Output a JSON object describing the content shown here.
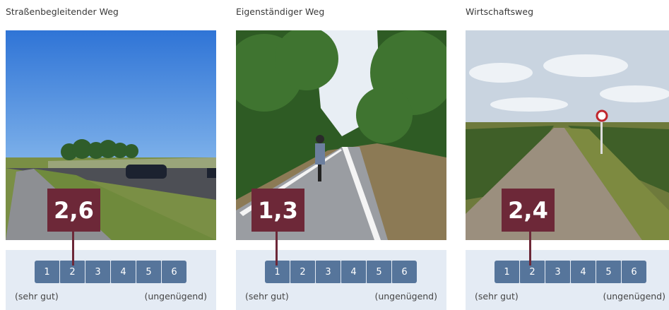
{
  "cards": [
    {
      "title": "Straßenbegleitender Weg",
      "score": "2,6",
      "grades": [
        "1",
        "2",
        "3",
        "4",
        "5",
        "6"
      ],
      "label_best": "(sehr gut)",
      "label_worst": "(ungenügend)"
    },
    {
      "title": "Eigenständiger Weg",
      "score": "1,3",
      "grades": [
        "1",
        "2",
        "3",
        "4",
        "5",
        "6"
      ],
      "label_best": "(sehr gut)",
      "label_worst": "(ungenügend)"
    },
    {
      "title": "Wirtschaftsweg",
      "score": "2,4",
      "grades": [
        "1",
        "2",
        "3",
        "4",
        "5",
        "6"
      ],
      "label_best": "(sehr gut)",
      "label_worst": "(ungenügend)"
    }
  ],
  "colors": {
    "badge": "#6d2838",
    "grade_cell": "#56759b",
    "scale_background": "#e4ebf4"
  }
}
